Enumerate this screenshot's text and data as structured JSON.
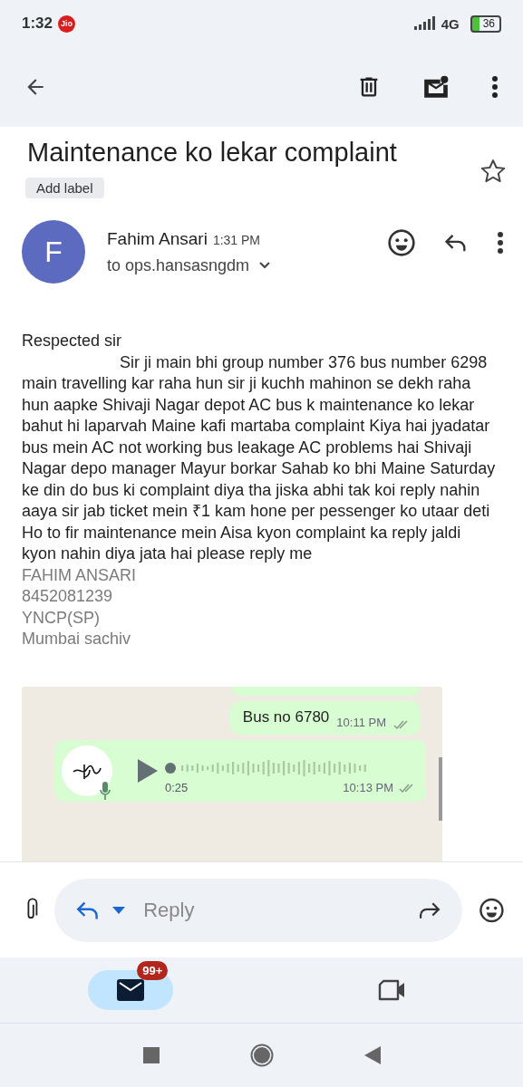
{
  "status_bar": {
    "time": "1:32",
    "carrier": "Jio",
    "network": "4G",
    "battery": "36"
  },
  "subject": "Maintenance ko lekar complaint",
  "label_chip": "Add label",
  "starred": false,
  "sender": {
    "initial": "F",
    "name": "Fahim Ansari",
    "time": "1:31 PM",
    "recipient": "to ops.hansasngdm"
  },
  "body": {
    "greeting": "Respected sir",
    "paragraph": "Sir ji main bhi group number 376 bus number 6298 main travelling kar raha hun sir ji kuchh mahinon se dekh raha hun aapke Shivaji Nagar depot AC bus k maintenance ko lekar bahut hi laparvah Maine kafi martaba complaint Kiya hai jyadatar bus mein AC not working bus leakage AC problems hai Shivaji Nagar depo manager Mayur borkar Sahab ko bhi Maine Saturday ke din do bus ki complaint diya tha jiska abhi tak koi reply nahin aaya sir jab ticket mein ₹1 kam hone per pessenger ko utaar deti Ho to fir maintenance mein Aisa kyon complaint ka reply jaldi kyon nahin diya jata hai please reply me",
    "signature": [
      "FAHIM ANSARI",
      "8452081239",
      "YNCP(SP)",
      "Mumbai sachiv"
    ]
  },
  "attachment": {
    "messages": [
      {
        "kind": "text",
        "text": "Bus no 6780",
        "time": "10:11 PM"
      },
      {
        "kind": "voice",
        "duration": "0:25",
        "time": "10:13 PM"
      }
    ]
  },
  "reply_bar": {
    "placeholder": "Reply"
  },
  "bottom_nav": [
    {
      "kind": "mail",
      "badge": "99+",
      "selected": true
    },
    {
      "kind": "video",
      "selected": false
    }
  ]
}
